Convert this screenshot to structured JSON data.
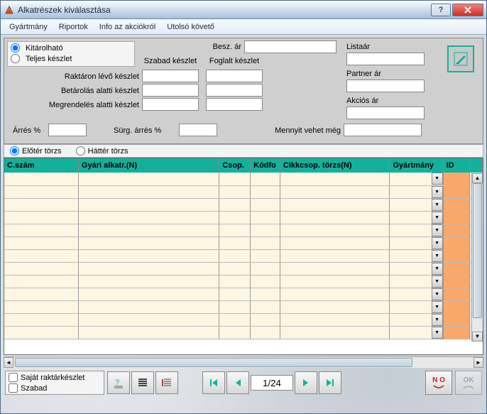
{
  "window": {
    "title": "Alkatrészek kiválasztása"
  },
  "menu": {
    "items": [
      "Gyártmány",
      "Riportok",
      "Info az akciókról",
      "Utolsó követő"
    ]
  },
  "radios_left": {
    "opt1": "Kitárolható",
    "opt2": "Teljes készlet"
  },
  "stock_headers": {
    "free": "Szabad készlet",
    "reserved": "Foglalt készlet"
  },
  "stock_rows": {
    "r1": "Raktáron lévő készlet",
    "r2": "Betárolás alatti készlet",
    "r3": "Megrendelés alatti készlet"
  },
  "price_labels": {
    "besz": "Besz. ár",
    "lista": "Listaár",
    "partner": "Partner ár",
    "akcios": "Akciós ár"
  },
  "bottom_line": {
    "arres": "Árrés %",
    "surg": "Sürg. árrés %",
    "mennyit": "Mennyit vehet még"
  },
  "table_radios": {
    "eloter": "Előtér törzs",
    "hatter": "Háttér törzs"
  },
  "table": {
    "headers": [
      "C.szám",
      "Gyári alkatr.(N)",
      "Csop.",
      "Kódfo",
      "Cikkcsop. törzs(N)",
      "Gyártmány",
      "ID"
    ],
    "row_count": 13
  },
  "footer": {
    "chk1": "Saját raktárkészlet",
    "chk2": "Szabad",
    "pager": "1/24",
    "no": "N O",
    "ok": "OK"
  }
}
